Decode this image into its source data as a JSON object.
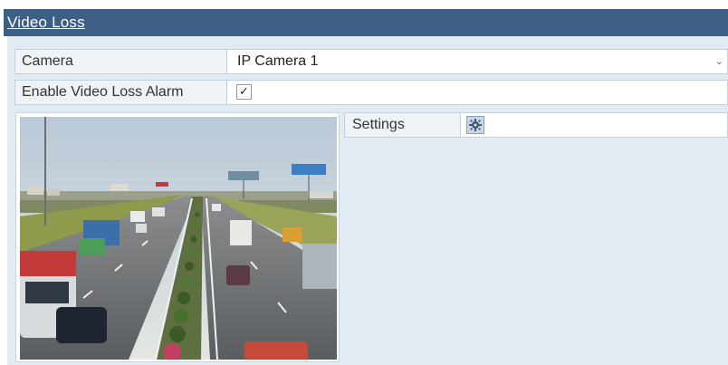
{
  "header": {
    "title": "Video Loss"
  },
  "camera": {
    "label": "Camera",
    "value": "IP Camera 1",
    "chevron": "⌄"
  },
  "alarm": {
    "label": "Enable Video Loss Alarm",
    "checked": true,
    "check_glyph": "✓"
  },
  "settings": {
    "label": "Settings",
    "icon": "gear-icon"
  },
  "preview": {
    "icon": "camera-preview"
  },
  "colors": {
    "header_bg": "#3d5f85",
    "panel_bg": "#e2eaf2",
    "label_bg": "#eef3f8"
  }
}
